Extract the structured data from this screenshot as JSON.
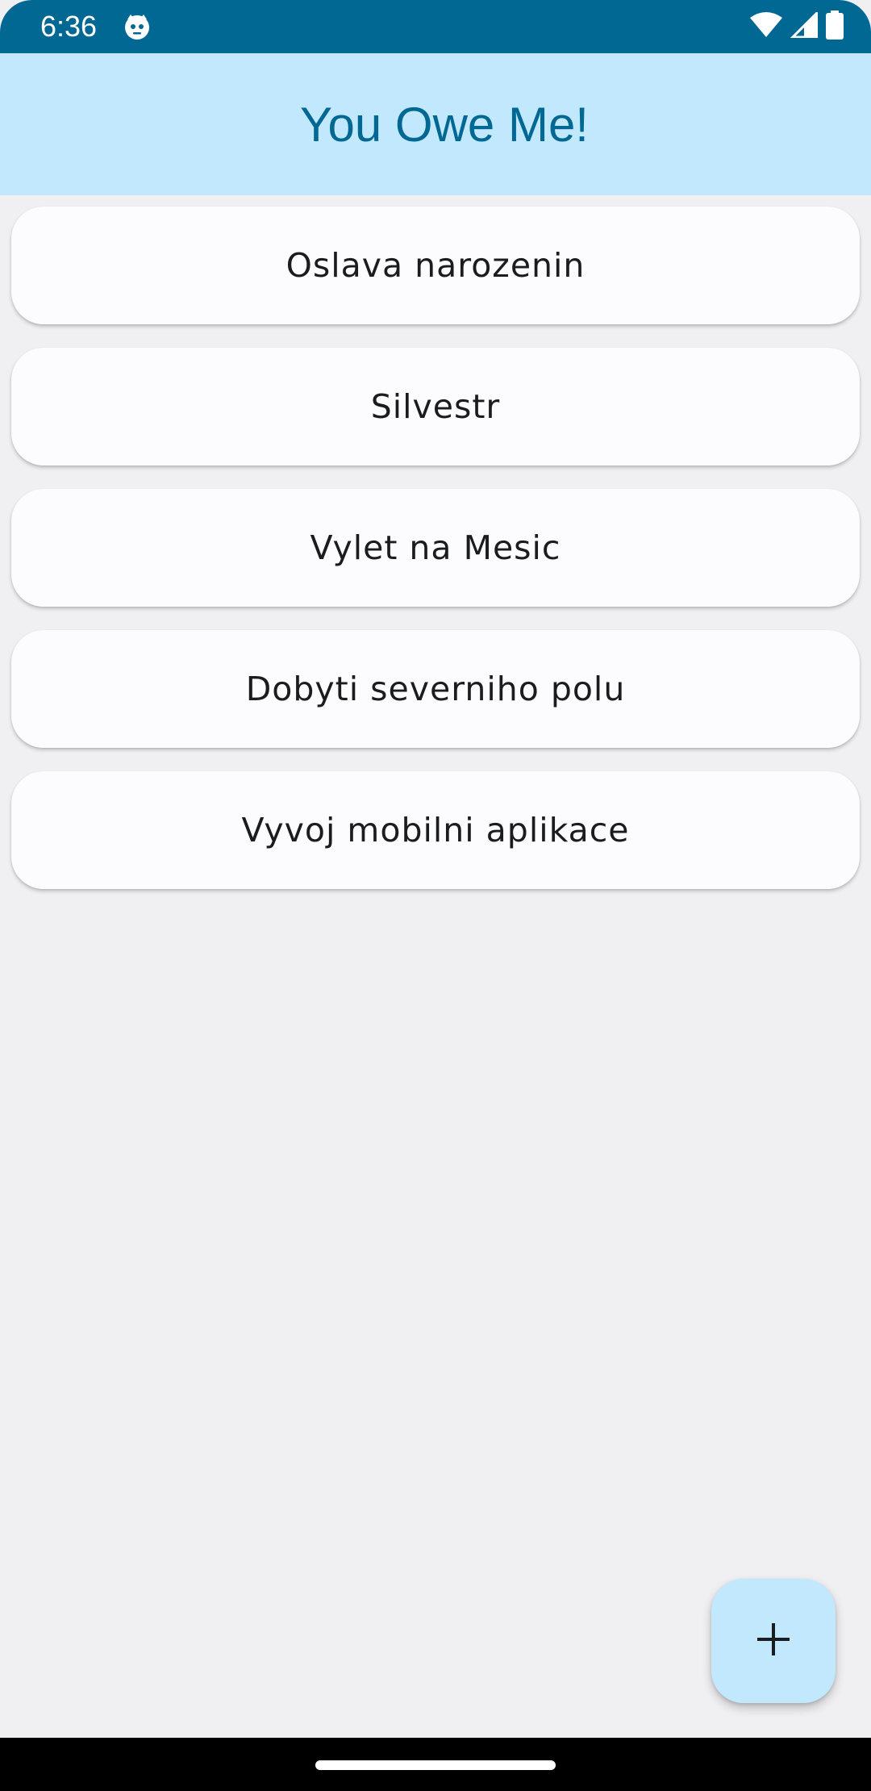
{
  "status_bar": {
    "time": "6:36",
    "icons": [
      "app-notification-icon",
      "wifi-icon",
      "signal-icon",
      "battery-icon"
    ],
    "background": "#006892"
  },
  "app_bar": {
    "title": "You Owe Me!",
    "background": "#c1e8fd",
    "title_color": "#006892"
  },
  "events": [
    {
      "label": "Oslava narozenin"
    },
    {
      "label": "Silvestr"
    },
    {
      "label": "Vylet na Mesic"
    },
    {
      "label": "Dobyti severniho polu"
    },
    {
      "label": "Vyvoj mobilni aplikace"
    }
  ],
  "fab": {
    "icon": "add-icon",
    "background": "#c1e8fd"
  }
}
